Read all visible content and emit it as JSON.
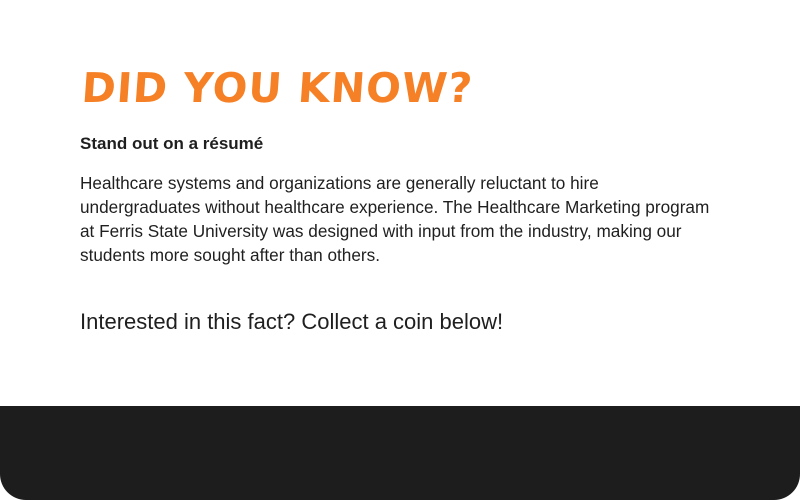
{
  "fact_card": {
    "title": "Did you know?",
    "subtitle": "Stand out on a résumé",
    "body": "Healthcare systems and organizations are generally reluctant to hire undergraduates without healthcare experience. The Healthcare Marketing program at Ferris State University was designed with input from the industry, making our students more sought after than others.",
    "prompt": "Interested in this fact? Collect a coin below!"
  },
  "colors": {
    "accent": "#f58025",
    "text": "#1f1f1f",
    "footer": "#1d1d1d",
    "background": "#ffffff"
  }
}
